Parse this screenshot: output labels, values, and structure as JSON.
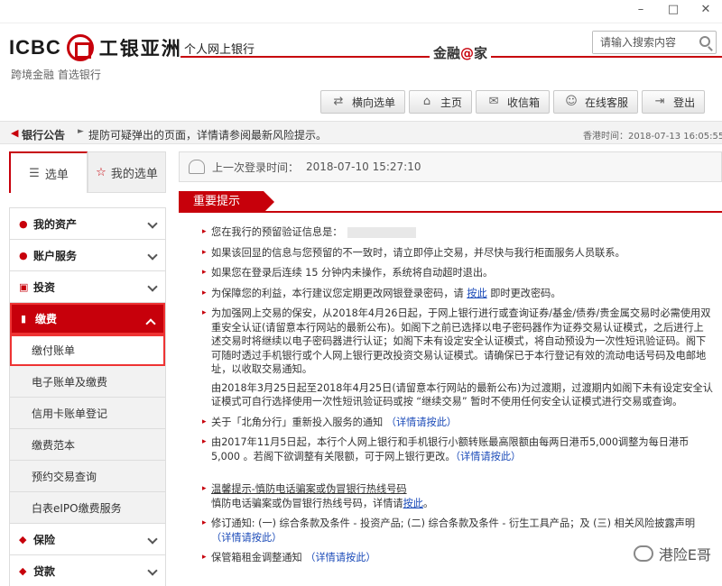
{
  "window": {
    "min": "–",
    "max": "□",
    "close": "✕"
  },
  "header": {
    "logo_en": "ICBC",
    "logo_cn": "工银亚洲",
    "slogan": "跨境金融 首选银行",
    "product": "个人网上银行",
    "brand_left": "金融",
    "brand_at": "@",
    "brand_right": "家",
    "search_placeholder": "请输入搜索内容"
  },
  "toolbar": [
    {
      "label": "横向选单",
      "icon": "swap-arrows-icon"
    },
    {
      "label": "主页",
      "icon": "home-icon"
    },
    {
      "label": "收信箱",
      "icon": "mail-icon"
    },
    {
      "label": "在线客服",
      "icon": "agent-icon"
    },
    {
      "label": "登出",
      "icon": "logout-icon"
    }
  ],
  "notice": {
    "label": "银行公告",
    "text": "提防可疑弹出的页面，详情请参阅最新风险提示。",
    "time_label": "香港时间：",
    "time_value": "2018-07-13 16:05:55"
  },
  "sidebar": {
    "tabs": [
      {
        "label": "选单"
      },
      {
        "label": "我的选单"
      }
    ],
    "menu": [
      {
        "label": "我的资产",
        "icon": "person-icon"
      },
      {
        "label": "账户服务",
        "icon": "user-icon"
      },
      {
        "label": "投资",
        "icon": "invest-icon"
      },
      {
        "label": "缴费",
        "icon": "bill-icon"
      }
    ],
    "sub": [
      "缴付账单",
      "电子账单及缴费",
      "信用卡账单登记",
      "缴费范本",
      "预约交易查询",
      "白表eIPO缴费服务"
    ],
    "menu2": [
      {
        "label": "保险",
        "icon": "insurance-icon"
      },
      {
        "label": "贷款",
        "icon": "loan-icon"
      }
    ]
  },
  "main": {
    "last_login_label": "上一次登录时间：",
    "last_login_value": "2018-07-10 15:27:10",
    "tab_title": "重要提示",
    "items": [
      "您在我行的预留验证信息是：",
      "如果该回显的信息与您预留的不一致时，请立即停止交易，并尽快与我行柜面服务人员联系。",
      "如果您在登录后连续 15 分钟内未操作，系统将自动超时退出。",
      "为保障您的利益，本行建议您定期更改网银登录密码，请 ",
      "按此",
      " 即时更改密码。",
      "为加强网上交易的保安，从2018年4月26日起，于网上银行进行或查询证券/基金/债券/贵金属交易时必需使用双重安全认证(请留意本行网站的最新公布)。如阁下之前已选择以电子密码器作为证券交易认证模式，之后进行上述交易时将继续以电子密码器进行认证；如阁下未有设定安全认证模式，将自动预设为一次性短讯验证码。阁下可随时透过手机银行或个人网上银行更改投资交易认证模式。请确保已于本行登记有效的流动电话号码及电邮地址，以收取交易通知。",
      "由2018年3月25日起至2018年4月25日(请留意本行网站的最新公布)为过渡期，过渡期内如阁下未有设定安全认证模式可自行选择使用一次性短讯验证码或按 “继续交易” 暂时不使用任何安全认证模式进行交易或查询。",
      "关于「北角分行」重新投入服务的通知 ",
      "（详情请按此）",
      "由2017年11月5日起，本行个人网上银行和手机银行小额转账最高限额由每两日港币5,000调整为每日港币5,000 。若阁下欲调整有关限额，可于网上银行更改。",
      "（详情请按此）",
      "温馨提示-慎防电话骗案或伪冒银行热线号码",
      "慎防电话骗案或伪冒银行热线号码，详情请",
      "按此",
      "。",
      "修订通知: (一) 综合条款及条件 - 投资产品; (二) 综合条款及条件 - 衍生工具产品；及 (三) 相关风险披露声明",
      "（详情请按此）",
      "保管箱租金调整通知 ",
      "（详情请按此）"
    ],
    "watermark": "港险E哥"
  }
}
